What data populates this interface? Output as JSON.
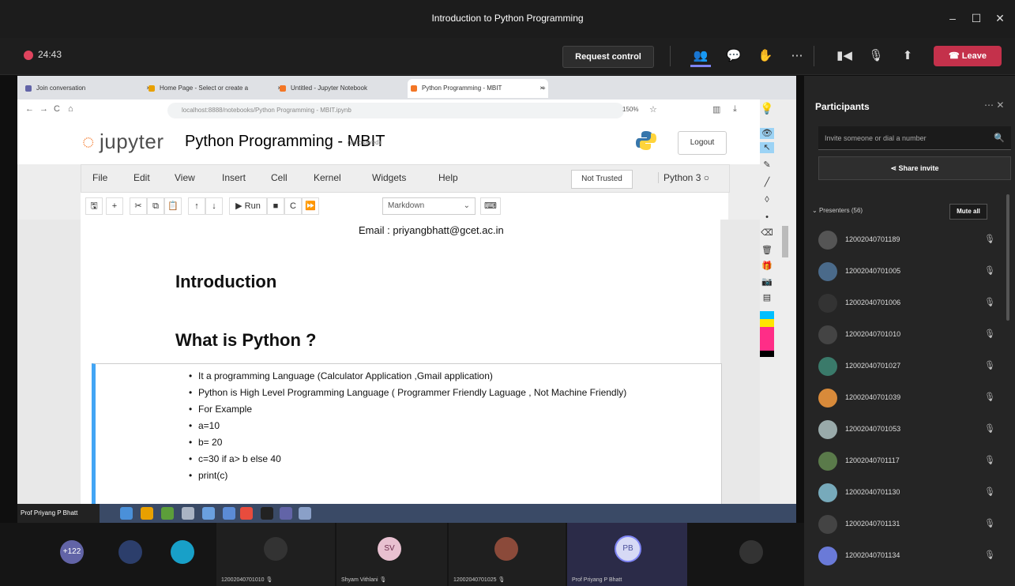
{
  "window": {
    "title": "Introduction to Python Programming"
  },
  "toolbar": {
    "timer": "24:43",
    "request_control": "Request control",
    "leave": "Leave"
  },
  "browser": {
    "tabs": [
      {
        "label": "Join conversation"
      },
      {
        "label": "Home Page - Select or create a"
      },
      {
        "label": "Untitled - Jupyter Notebook"
      },
      {
        "label": "Python Programming - MBIT"
      }
    ],
    "url": "localhost:8888/notebooks/Python Programming - MBIT.ipynb",
    "zoom": "150%"
  },
  "jupyter": {
    "logo": "jupyter",
    "notebook_title": "Python Programming - MBIT",
    "autosave": "(autosaved)",
    "logout": "Logout",
    "menu": [
      "File",
      "Edit",
      "View",
      "Insert",
      "Cell",
      "Kernel",
      "Widgets",
      "Help"
    ],
    "trust": "Not Trusted",
    "kernel": "Python 3",
    "run": "Run",
    "cell_type": "Markdown"
  },
  "notebook": {
    "email": "Email : priyangbhatt@gcet.ac.in",
    "h_intro": "Introduction",
    "h_what": "What is Python ?",
    "bullets": [
      "It a programming Language (Calculator Application ,Gmail application)",
      "Python is High Level Programming Language ( Programmer Friendly Laguage , Not Machine Friendly)",
      "For Example",
      "a=10",
      "b= 20",
      "c=30 if a> b else 40",
      "print(c)"
    ]
  },
  "presenter_tag": "Prof Priyang P Bhatt",
  "panel": {
    "title": "Participants",
    "invite_placeholder": "Invite someone or dial a number",
    "share_invite": "Share invite",
    "presenters_label": "Presenters (56)",
    "mute_all": "Mute all",
    "participants": [
      {
        "name": "12002040701189"
      },
      {
        "name": "12002040701005"
      },
      {
        "name": "12002040701006"
      },
      {
        "name": "12002040701010"
      },
      {
        "name": "12002040701027"
      },
      {
        "name": "12002040701039"
      },
      {
        "name": "12002040701053"
      },
      {
        "name": "12002040701117"
      },
      {
        "name": "12002040701130"
      },
      {
        "name": "12002040701131"
      },
      {
        "name": "12002040701134"
      }
    ]
  },
  "bottom": {
    "more_count": "+122",
    "tiles": [
      {
        "name": "12002040701010"
      },
      {
        "name": "Shyam Vithlani",
        "initials": "SV"
      },
      {
        "name": "12002040701025"
      },
      {
        "name": "Prof Priyang P Bhatt",
        "initials": "PB"
      }
    ]
  }
}
